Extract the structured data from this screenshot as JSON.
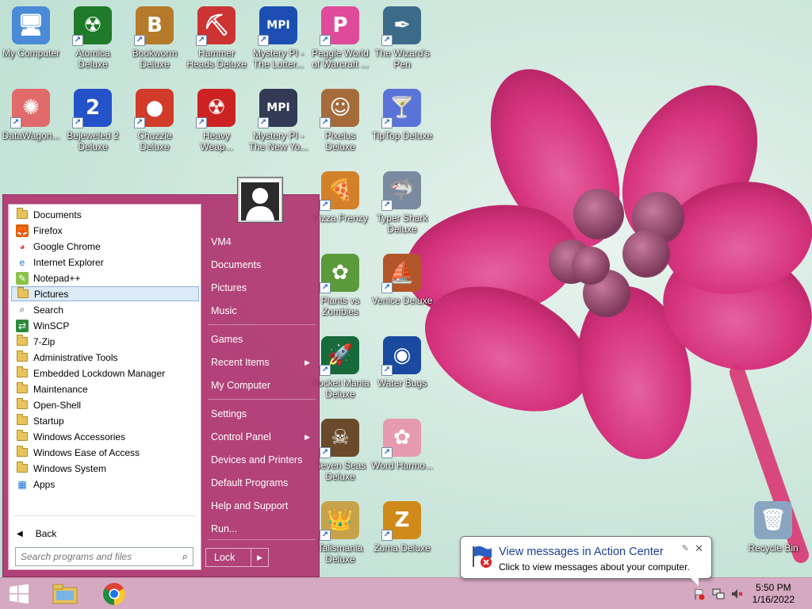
{
  "desktop": {
    "icons": [
      {
        "label": "My Computer",
        "glyph": "🖥",
        "bg": "#4a8bd8",
        "shortcut": false
      },
      {
        "label": "Atomica Deluxe",
        "glyph": "☢",
        "bg": "#1f7a2a",
        "shortcut": true
      },
      {
        "label": "Bookworm Deluxe",
        "glyph": "B",
        "bg": "#b57a2a",
        "shortcut": true
      },
      {
        "label": "Hammer Heads Deluxe",
        "glyph": "⛏",
        "bg": "#c33",
        "shortcut": true
      },
      {
        "label": "Mystery PI - The Lotter...",
        "glyph": "MPI",
        "bg": "#1d4fb3",
        "shortcut": true
      },
      {
        "label": "Peggle World of Warcraft ...",
        "glyph": "P",
        "bg": "#e04a9a",
        "shortcut": true
      },
      {
        "label": "The Wizard's Pen",
        "glyph": "✒",
        "bg": "#3c6b8a",
        "shortcut": true
      },
      {
        "label": "DataWagon...",
        "glyph": "✺",
        "bg": "#e16a6a",
        "shortcut": true
      },
      {
        "label": "Bejeweled 2 Deluxe",
        "glyph": "2",
        "bg": "#2452c8",
        "shortcut": true
      },
      {
        "label": "Chuzzle Deluxe",
        "glyph": "●",
        "bg": "#d23a2a",
        "shortcut": true
      },
      {
        "label": "Heavy Weap...",
        "glyph": "☢",
        "bg": "#c22",
        "shortcut": true
      },
      {
        "label": "Mystery PI - The New Yo...",
        "glyph": "MPI",
        "bg": "#333a55",
        "shortcut": true
      },
      {
        "label": "Pixelus Deluxe",
        "glyph": "☺",
        "bg": "#a56b3a",
        "shortcut": true
      },
      {
        "label": "TipTop Deluxe",
        "glyph": "🍸",
        "bg": "#5a73d8",
        "shortcut": true
      },
      {
        "label": "Pizza Frenzy",
        "glyph": "🍕",
        "bg": "#d2802a",
        "shortcut": true
      },
      {
        "label": "Typer Shark Deluxe",
        "glyph": "🦈",
        "bg": "#7a8aa0",
        "shortcut": true
      },
      {
        "label": "Plants vs Zombies",
        "glyph": "✿",
        "bg": "#5a9a3a",
        "shortcut": true
      },
      {
        "label": "Venice Deluxe",
        "glyph": "⛵",
        "bg": "#b2562a",
        "shortcut": true
      },
      {
        "label": "Rocket Mania Deluxe",
        "glyph": "🚀",
        "bg": "#186a3a",
        "shortcut": true
      },
      {
        "label": "Water Bugs",
        "glyph": "◉",
        "bg": "#1a4aa0",
        "shortcut": true
      },
      {
        "label": "Seven Seas Deluxe",
        "glyph": "☠",
        "bg": "#6a4a2a",
        "shortcut": true
      },
      {
        "label": "Word Harmo...",
        "glyph": "✿",
        "bg": "#e69ab0",
        "shortcut": true
      },
      {
        "label": "Talismania Deluxe",
        "glyph": "👑",
        "bg": "#c7a24a",
        "shortcut": true
      },
      {
        "label": "Zuma Deluxe",
        "glyph": "Z",
        "bg": "#d08a1a",
        "shortcut": true
      },
      {
        "label": "Recycle Bin",
        "glyph": "🗑",
        "bg": "#8aa5c0",
        "shortcut": false
      }
    ]
  },
  "start_menu": {
    "programs": [
      {
        "label": "Documents",
        "icon": "folder",
        "selected": false
      },
      {
        "label": "Firefox",
        "icon": "firefox",
        "selected": false
      },
      {
        "label": "Google Chrome",
        "icon": "chrome",
        "selected": false
      },
      {
        "label": "Internet Explorer",
        "icon": "ie",
        "selected": false
      },
      {
        "label": "Notepad++",
        "icon": "notepad",
        "selected": false
      },
      {
        "label": "Pictures",
        "icon": "folder",
        "selected": true
      },
      {
        "label": "Search",
        "icon": "search",
        "selected": false
      },
      {
        "label": "WinSCP",
        "icon": "winscp",
        "selected": false
      },
      {
        "label": "7-Zip",
        "icon": "folder",
        "selected": false
      },
      {
        "label": "Administrative Tools",
        "icon": "folder",
        "selected": false
      },
      {
        "label": "Embedded Lockdown Manager",
        "icon": "folder",
        "selected": false
      },
      {
        "label": "Maintenance",
        "icon": "folder",
        "selected": false
      },
      {
        "label": "Open-Shell",
        "icon": "folder",
        "selected": false
      },
      {
        "label": "Startup",
        "icon": "folder",
        "selected": false
      },
      {
        "label": "Windows Accessories",
        "icon": "folder",
        "selected": false
      },
      {
        "label": "Windows Ease of Access",
        "icon": "folder",
        "selected": false
      },
      {
        "label": "Windows System",
        "icon": "folder",
        "selected": false
      },
      {
        "label": "Apps",
        "icon": "apps",
        "selected": false
      }
    ],
    "back_label": "Back",
    "search_placeholder": "Search programs and files",
    "right_items": [
      {
        "label": "VM4",
        "submenu": false
      },
      {
        "label": "Documents",
        "submenu": false
      },
      {
        "label": "Pictures",
        "submenu": false
      },
      {
        "label": "Music",
        "submenu": false
      },
      {
        "label": "Games",
        "submenu": false
      },
      {
        "label": "Recent Items",
        "submenu": true
      },
      {
        "label": "My Computer",
        "submenu": false
      },
      {
        "label": "Settings",
        "submenu": false
      },
      {
        "label": "Control Panel",
        "submenu": true
      },
      {
        "label": "Devices and Printers",
        "submenu": false
      },
      {
        "label": "Default Programs",
        "submenu": false
      },
      {
        "label": "Help and Support",
        "submenu": false
      },
      {
        "label": "Run...",
        "submenu": false
      }
    ],
    "lock_label": "Lock"
  },
  "balloon": {
    "title": "View messages in Action Center",
    "body": "Click to view messages about your computer."
  },
  "taskbar": {
    "pinned": [
      "file-explorer-icon",
      "chrome-icon"
    ],
    "time": "5:50 PM",
    "date": "1/16/2022"
  },
  "colors": {
    "start_menu": "#b03470",
    "taskbar": "#d5a9c1",
    "selection": "#dcebf8"
  }
}
